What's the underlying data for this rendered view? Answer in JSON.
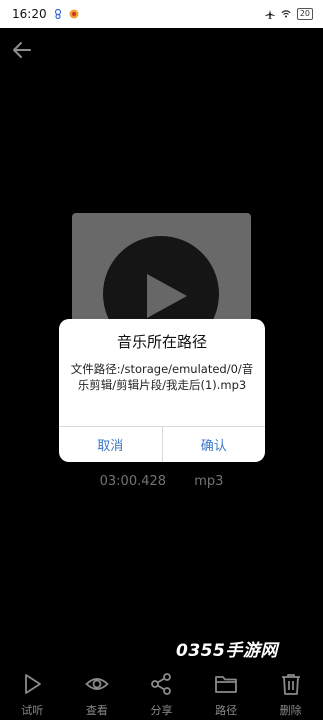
{
  "status_bar": {
    "time": "16:20",
    "battery": "20"
  },
  "media": {
    "duration": "03:00.428",
    "format": "mp3"
  },
  "dialog": {
    "title": "音乐所在路径",
    "message": "文件路径:/storage/emulated/0/音乐剪辑/剪辑片段/我走后(1).mp3",
    "cancel_label": "取消",
    "confirm_label": "确认"
  },
  "watermark": "0355手游网",
  "bottom_bar": {
    "items": [
      {
        "label": "试听",
        "icon": "play-icon"
      },
      {
        "label": "查看",
        "icon": "eye-icon"
      },
      {
        "label": "分享",
        "icon": "share-icon"
      },
      {
        "label": "路径",
        "icon": "folder-icon"
      },
      {
        "label": "删除",
        "icon": "trash-icon"
      }
    ]
  },
  "colors": {
    "background": "#000000",
    "accent": "#3a78c9",
    "muted_text": "#8a8a8a"
  }
}
